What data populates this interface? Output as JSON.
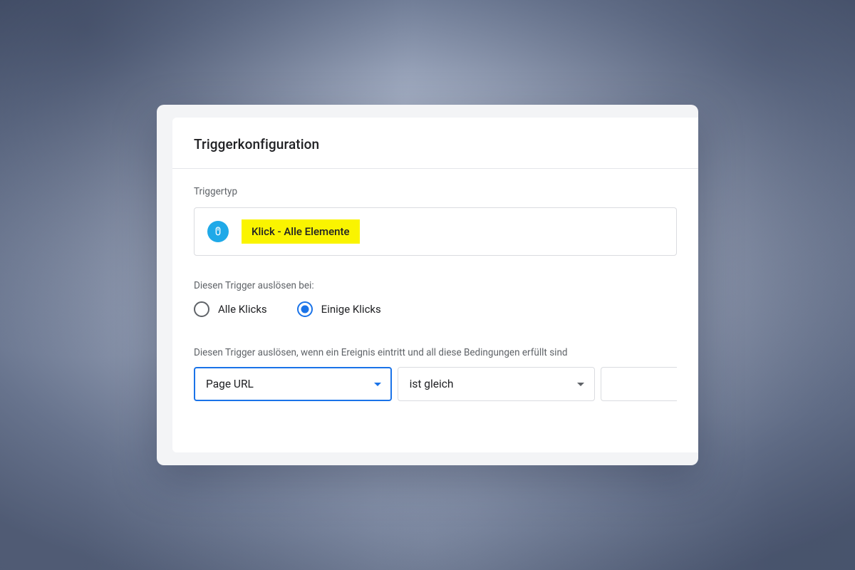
{
  "header": {
    "title": "Triggerkonfiguration"
  },
  "triggerType": {
    "label": "Triggertyp",
    "name": "Klick - Alle Elemente",
    "iconName": "mouse-click-icon"
  },
  "fireOn": {
    "label": "Diesen Trigger auslösen bei:",
    "options": [
      {
        "label": "Alle Klicks",
        "checked": false
      },
      {
        "label": "Einige Klicks",
        "checked": true
      }
    ]
  },
  "conditions": {
    "label": "Diesen Trigger auslösen, wenn ein Ereignis eintritt und all diese Bedingungen erfüllt sind",
    "variable": "Page URL",
    "operator": "ist gleich",
    "value": ""
  }
}
